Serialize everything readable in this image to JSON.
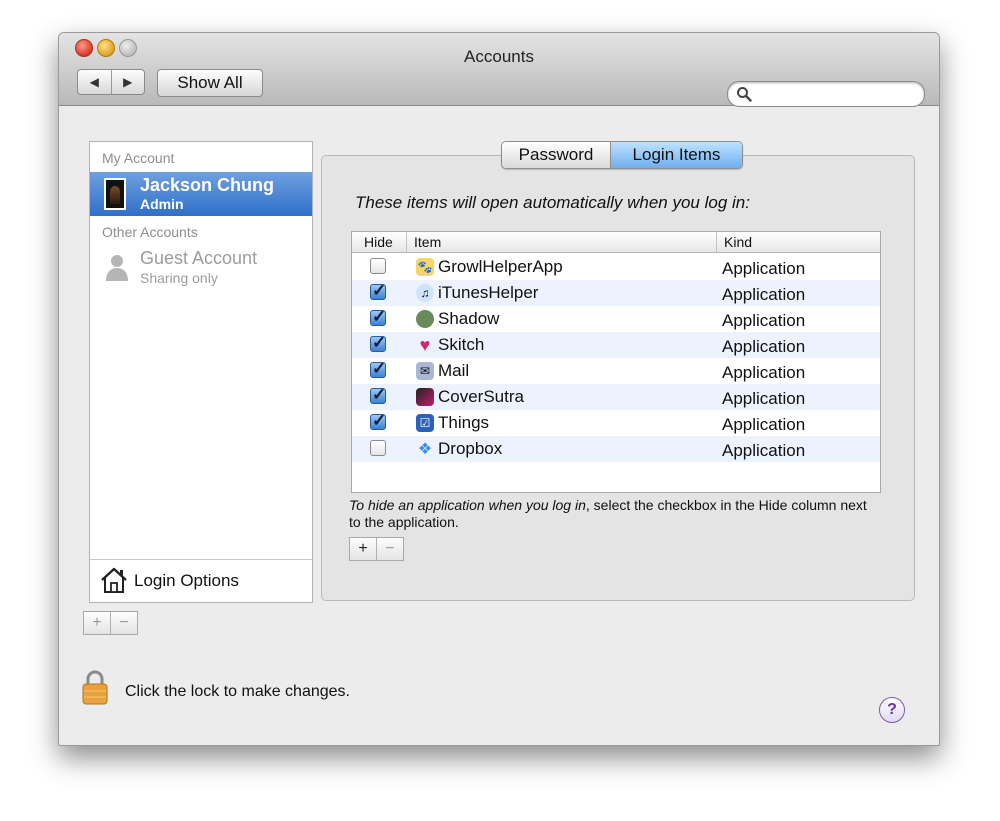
{
  "window": {
    "title": "Accounts"
  },
  "toolbar": {
    "back_label": "◀",
    "forward_label": "▶",
    "show_all_label": "Show All"
  },
  "search": {
    "placeholder": "",
    "icon": "magnifier-icon"
  },
  "sidebar": {
    "my_account_header": "My Account",
    "current_user": {
      "name": "Jackson Chung",
      "role": "Admin"
    },
    "other_accounts_header": "Other Accounts",
    "guest": {
      "name": "Guest Account",
      "subtitle": "Sharing only"
    },
    "login_options_label": "Login Options",
    "add_label": "+",
    "remove_label": "−"
  },
  "tabs": {
    "password": "Password",
    "login_items": "Login Items",
    "selected": "Login Items"
  },
  "login_items": {
    "intro": "These items will open automatically when you log in:",
    "columns": {
      "hide": "Hide",
      "item": "Item",
      "kind": "Kind"
    },
    "rows": [
      {
        "hide": false,
        "item": "GrowlHelperApp",
        "kind": "Application",
        "icon": "growl-icon"
      },
      {
        "hide": true,
        "item": "iTunesHelper",
        "kind": "Application",
        "icon": "itunes-icon"
      },
      {
        "hide": true,
        "item": "Shadow",
        "kind": "Application",
        "icon": "shadow-icon"
      },
      {
        "hide": true,
        "item": "Skitch",
        "kind": "Application",
        "icon": "skitch-icon"
      },
      {
        "hide": true,
        "item": "Mail",
        "kind": "Application",
        "icon": "mail-icon"
      },
      {
        "hide": true,
        "item": "CoverSutra",
        "kind": "Application",
        "icon": "coversutra-icon"
      },
      {
        "hide": true,
        "item": "Things",
        "kind": "Application",
        "icon": "things-icon"
      },
      {
        "hide": false,
        "item": "Dropbox",
        "kind": "Application",
        "icon": "dropbox-icon"
      }
    ],
    "hint_lead": "To hide an application when you log in",
    "hint_rest": ", select the checkbox in the Hide column next to the application.",
    "add_label": "+",
    "remove_label": "−"
  },
  "footer": {
    "lock_text": "Click the lock to make changes.",
    "help_label": "?"
  }
}
